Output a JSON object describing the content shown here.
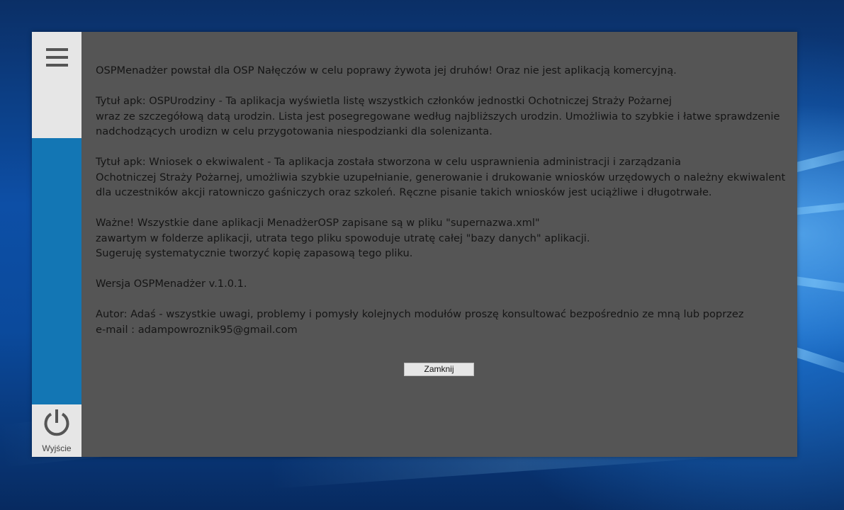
{
  "sidebar": {
    "menu_icon": "hamburger-menu-icon",
    "exit_icon": "power-icon",
    "exit_label": "Wyjście",
    "accent_color": "#1376b4"
  },
  "content": {
    "intro": "OSPMenadżer powstał dla OSP Nałęczów w celu poprawy żywota jej druhów! Oraz nie jest aplikacją komercyjną.",
    "app1_line1": "Tytuł apk: OSPUrodziny - Ta aplikacja wyświetla listę wszystkich członków jednostki Ochotniczej Straży Pożarnej",
    "app1_line2": "wraz ze szczegółową datą urodzin. Lista jest posegregowane według najbliższych urodzin. Umożliwia to szybkie i łatwe sprawdzenie",
    "app1_line3": "nadchodzących urodizn w celu przygotowania niespodzianki dla solenizanta.",
    "app2_line1": "Tytuł apk: Wniosek o ekwiwalent - Ta aplikacja została stworzona w celu usprawnienia administracji i zarządzania",
    "app2_line2": "Ochotniczej Straży Pożarnej, umożliwia szybkie uzupełnianie, generowanie i drukowanie wniosków urzędowych o należny ekwiwalent",
    "app2_line3": "dla uczestników akcji ratowniczo gaśniczych oraz szkoleń. Ręczne pisanie takich wniosków jest uciążliwe i długotrwałe.",
    "warn_line1": "Ważne! Wszystkie dane aplikacji MenadżerOSP zapisane są w pliku \"supernazwa.xml\"",
    "warn_line2": "zawartym w folderze aplikacji, utrata tego pliku spowoduje utratę całej \"bazy danych\" aplikacji.",
    "warn_line3": "Sugeruję systematycznie tworzyć kopię zapasową tego pliku.",
    "version": "Wersja OSPMenadżer v.1.0.1.",
    "author_line1": "Autor: Adaś - wszystkie uwagi, problemy i pomysły kolejnych modułów proszę konsultować bezpośrednio ze mną lub poprzez",
    "author_line2": "e-mail : adampowroznik95@gmail.com"
  },
  "close_button_label": "Zamknij"
}
